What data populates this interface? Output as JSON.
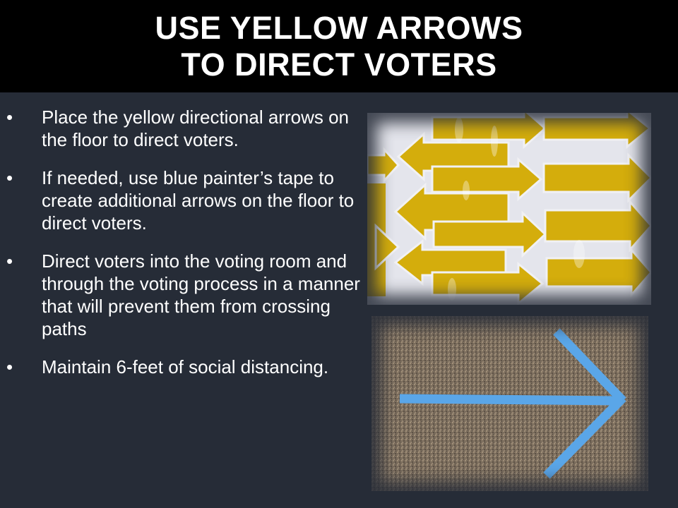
{
  "slide": {
    "title_lines": [
      "USE YELLOW ARROWS",
      "TO DIRECT VOTERS"
    ],
    "bullet_char": "•",
    "bullets": [
      "Place the yellow directional arrows on the floor to direct voters.",
      "If needed, use blue painter’s tape to create additional arrows on the floor to direct voters.",
      "Direct voters into the voting room and through the voting process in a manner that will prevent them from crossing paths",
      "Maintain 6-feet of social distancing."
    ]
  },
  "colors": {
    "title_bg": "#000000",
    "body_bg": "#262c37",
    "text": "#ffffff",
    "arrow_yellow": "#d4ad0c",
    "tape_blue": "#5aa6e8"
  },
  "images": [
    {
      "name": "yellow-arrow-stickers-photo"
    },
    {
      "name": "blue-tape-arrow-on-carpet-photo"
    }
  ]
}
